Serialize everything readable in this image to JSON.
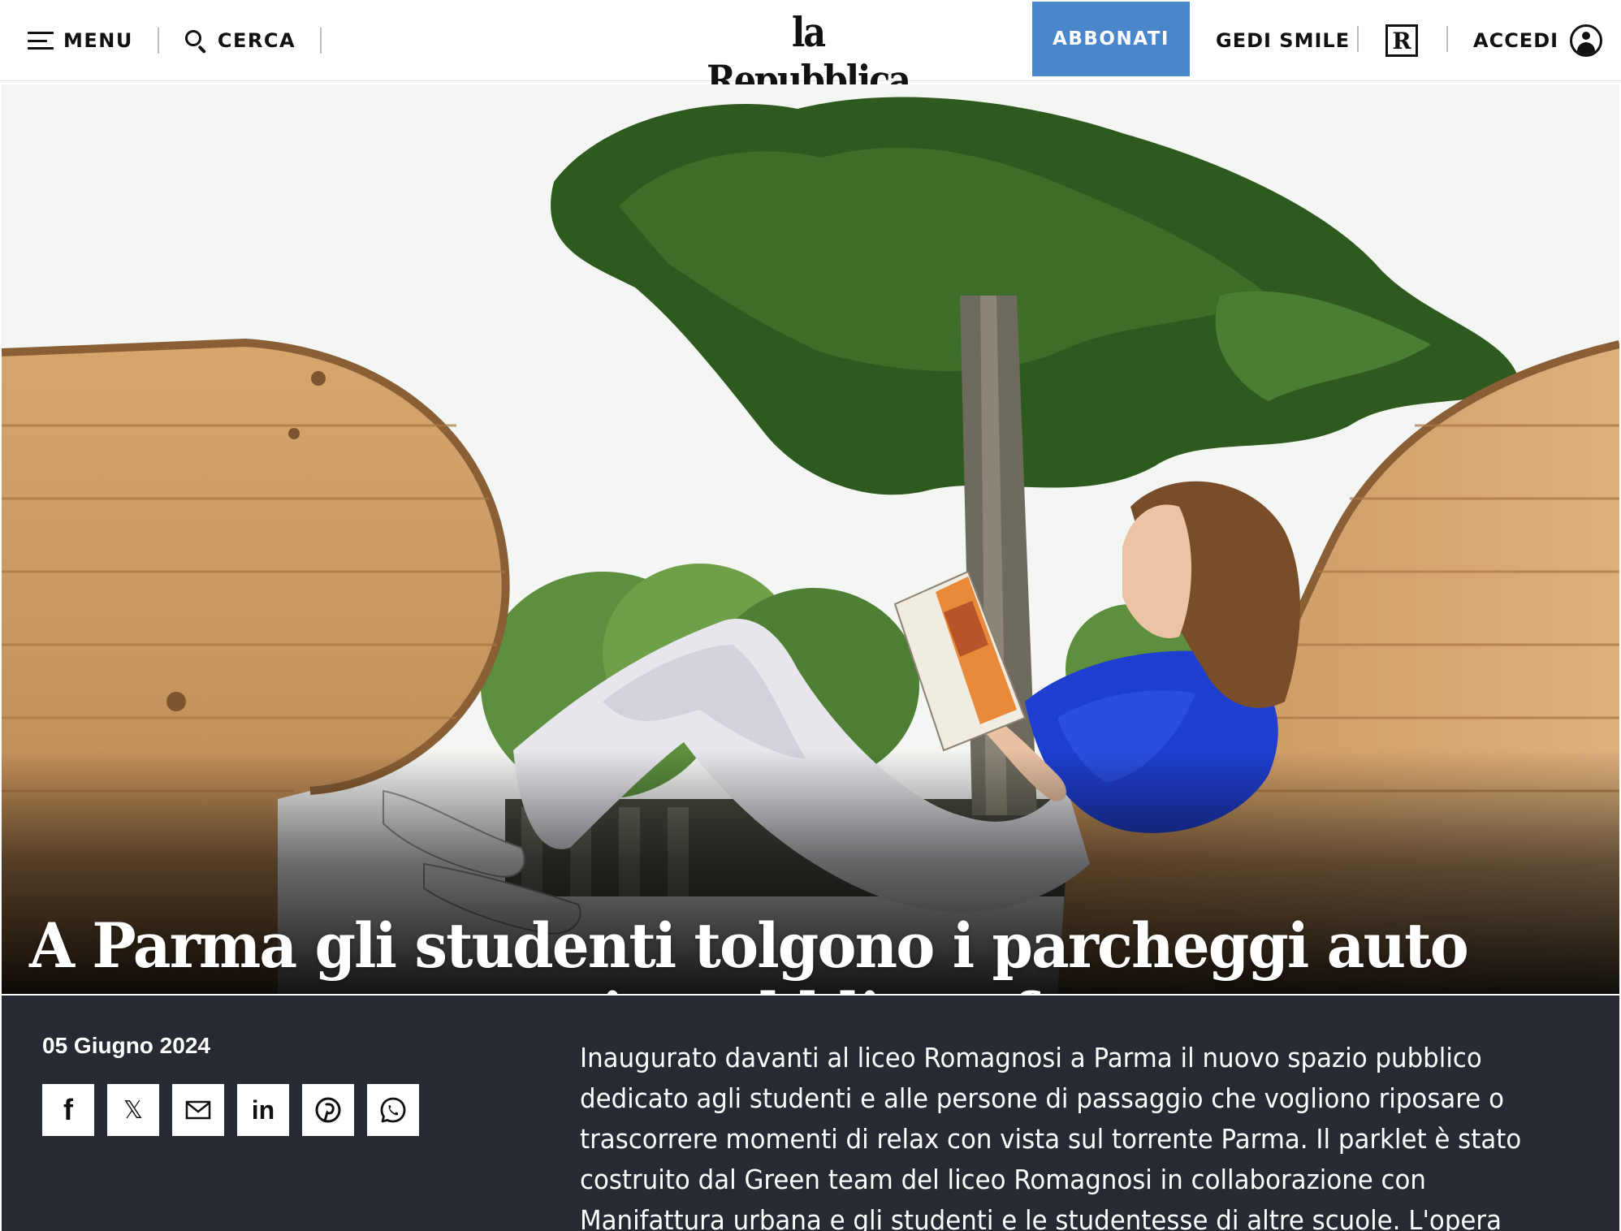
{
  "header": {
    "menu_label": "MENU",
    "search_label": "CERCA",
    "logo_text": "la Repubblica",
    "subscribe_label": "ABBONATI",
    "gedi_label": "GEDI SMILE",
    "r_icon_text": "R",
    "login_label": "ACCEDI"
  },
  "article": {
    "headline": "A Parma gli studenti tolgono i parcheggi auto per un nuovo spazio pubblico - foto",
    "date": "05 Giugno 2024",
    "summary": "Inaugurato davanti al liceo Romagnosi a Parma il nuovo spazio pubblico dedicato agli studenti e alle persone di passaggio che vogliono riposare o trascorrere momenti di relax con vista sul torrente Parma. Il parklet è stato costruito dal Green team del liceo Romagnosi in collaborazione con Manifattura urbana e gli studenti e le studentesse di altre scuole. L'opera"
  },
  "share": {
    "facebook": "f",
    "x": "𝕏",
    "linkedin": "in"
  },
  "colors": {
    "subscribe_bg": "#4a86cc",
    "lower_bg": "#252a33"
  }
}
